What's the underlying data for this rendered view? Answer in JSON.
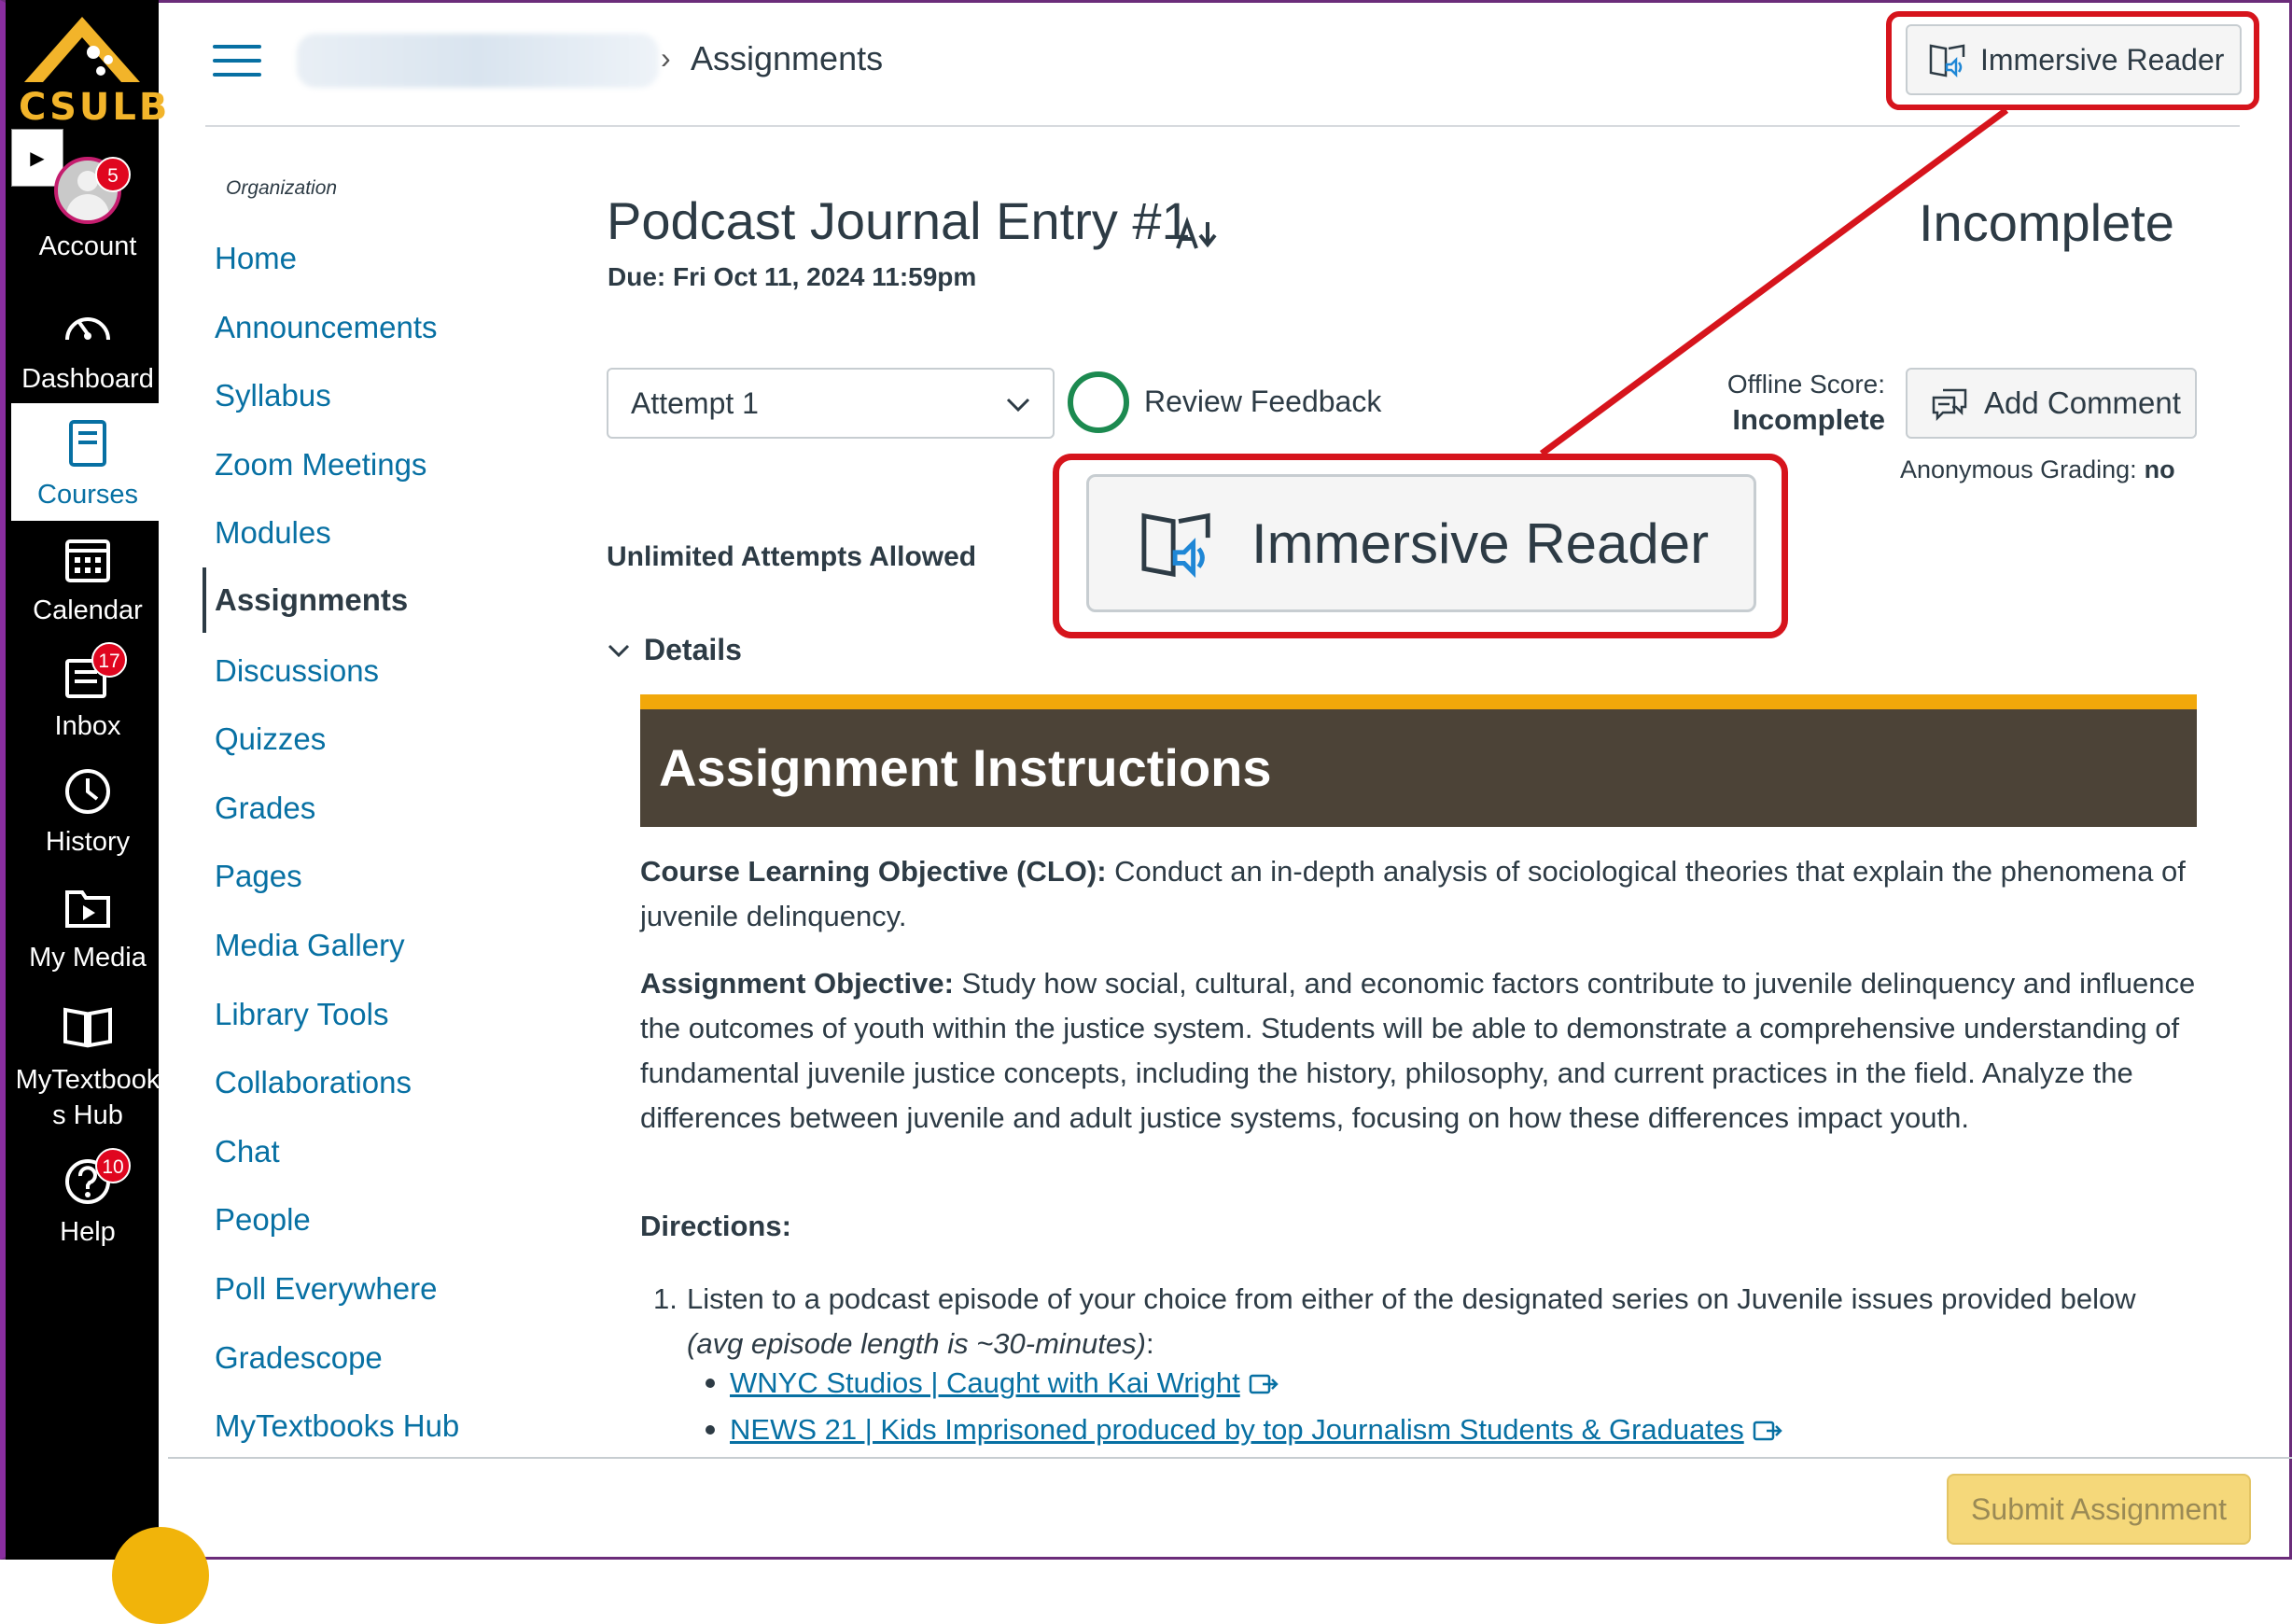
{
  "global_nav": {
    "logo_text": "CSULB",
    "items": [
      {
        "label": "Account",
        "badge": "5"
      },
      {
        "label": "Dashboard"
      },
      {
        "label": "Courses"
      },
      {
        "label": "Calendar"
      },
      {
        "label": "Inbox",
        "badge": "17"
      },
      {
        "label": "History"
      },
      {
        "label": "My Media"
      },
      {
        "label": "MyTextbook",
        "label2": "s Hub"
      },
      {
        "label": "Help",
        "badge": "10"
      }
    ],
    "active_color": "#0770a3"
  },
  "header": {
    "breadcrumb_current": "Assignments",
    "immersive_reader_label": "Immersive Reader"
  },
  "course_nav": {
    "heading": "Organization",
    "items": [
      "Home",
      "Announcements",
      "Syllabus",
      "Zoom Meetings",
      "Modules",
      "Assignments",
      "Discussions",
      "Quizzes",
      "Grades",
      "Pages",
      "Media Gallery",
      "Library Tools",
      "Collaborations",
      "Chat",
      "People",
      "Poll Everywhere",
      "Gradescope",
      "MyTextbooks Hub"
    ],
    "active": "Assignments"
  },
  "assignment": {
    "title": "Podcast Journal Entry #1",
    "due": "Due: Fri Oct 11, 2024 11:59pm",
    "status": "Incomplete",
    "attempt_selected": "Attempt 1",
    "review_feedback": "Review Feedback",
    "offline_score_label": "Offline Score:",
    "offline_score_value": "Incomplete",
    "add_comment": "Add Comment",
    "anonymous_grading_label": "Anonymous Grading:",
    "anonymous_grading_value": "no",
    "unlimited": "Unlimited Attempts Allowed",
    "details": "Details",
    "immersive_reader_zoom_label": "Immersive Reader"
  },
  "content": {
    "banner_title": "Assignment Instructions",
    "clo_label": "Course Learning Objective (CLO):",
    "clo_text": " Conduct an in-depth analysis of sociological theories that explain the phenomena of juvenile delinquency.",
    "ao_label": "Assignment Objective:",
    "ao_text": " Study how social, cultural, and economic factors contribute to juvenile delinquency and influence the outcomes of youth within the justice system. Students will be able to demonstrate a comprehensive understanding of fundamental juvenile justice concepts, including the history, philosophy, and current practices in the field. Analyze the differences between juvenile and adult justice systems, focusing on how these differences impact youth.",
    "directions_label": "Directions:",
    "step1_num": "1.",
    "step1_text": "Listen to a podcast episode of your choice from either of the designated series on Juvenile issues provided below",
    "step1_note": "(avg episode length is ~30-minutes)",
    "step1_colon": ":",
    "links": [
      "WNYC Studios | Caught with Kai Wright",
      "NEWS 21 | Kids Imprisoned produced by top Journalism Students & Graduates"
    ]
  },
  "footer": {
    "submit_label": "Submit Assignment"
  },
  "colors": {
    "callout": "#d6141c",
    "banner_bg": "#4c4337",
    "banner_accent": "#f1a80a",
    "link": "#0770a3"
  }
}
